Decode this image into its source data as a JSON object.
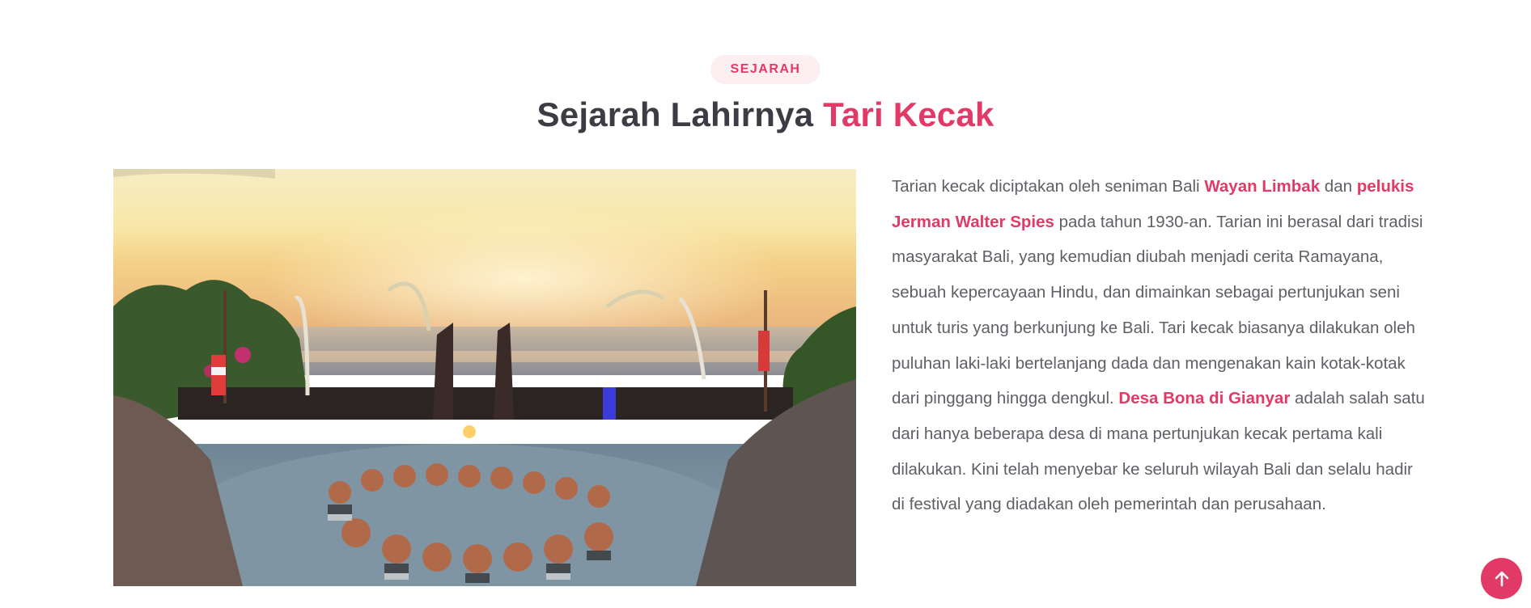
{
  "section": {
    "badge": "SEJARAH",
    "title_prefix": "Sejarah Lahirnya",
    "title_accent": "Tari Kecak"
  },
  "content": {
    "p1": "Tarian kecak diciptakan oleh seniman Bali",
    "hl1": "Wayan Limbak",
    "p2": "dan",
    "hl2": "pelukis Jerman Walter Spies",
    "p3": "pada tahun 1930-an. Tarian ini berasal dari tradisi masyarakat Bali, yang kemudian diubah menjadi cerita Ramayana, sebuah kepercayaan Hindu, dan dimainkan sebagai pertunjukan seni untuk turis yang berkunjung ke Bali. Tari kecak biasanya dilakukan oleh puluhan laki-laki bertelanjang dada dan mengenakan kain kotak-kotak dari pinggang hingga dengkul.",
    "hl3": "Desa Bona di Gianyar",
    "p4": "adalah salah satu dari hanya beberapa desa di mana pertunjukan kecak pertama kali dilakukan. Kini telah menyebar ke seluruh wilayah Bali dan selalu hadir di festival yang diadakan oleh pemerintah dan perusahaan."
  },
  "icons": {
    "scroll_top": "arrow-up-icon"
  },
  "colors": {
    "accent": "#e23a66",
    "badge_bg": "#fdeef2",
    "heading": "#3c3c44",
    "body_text": "#5f5f66"
  }
}
